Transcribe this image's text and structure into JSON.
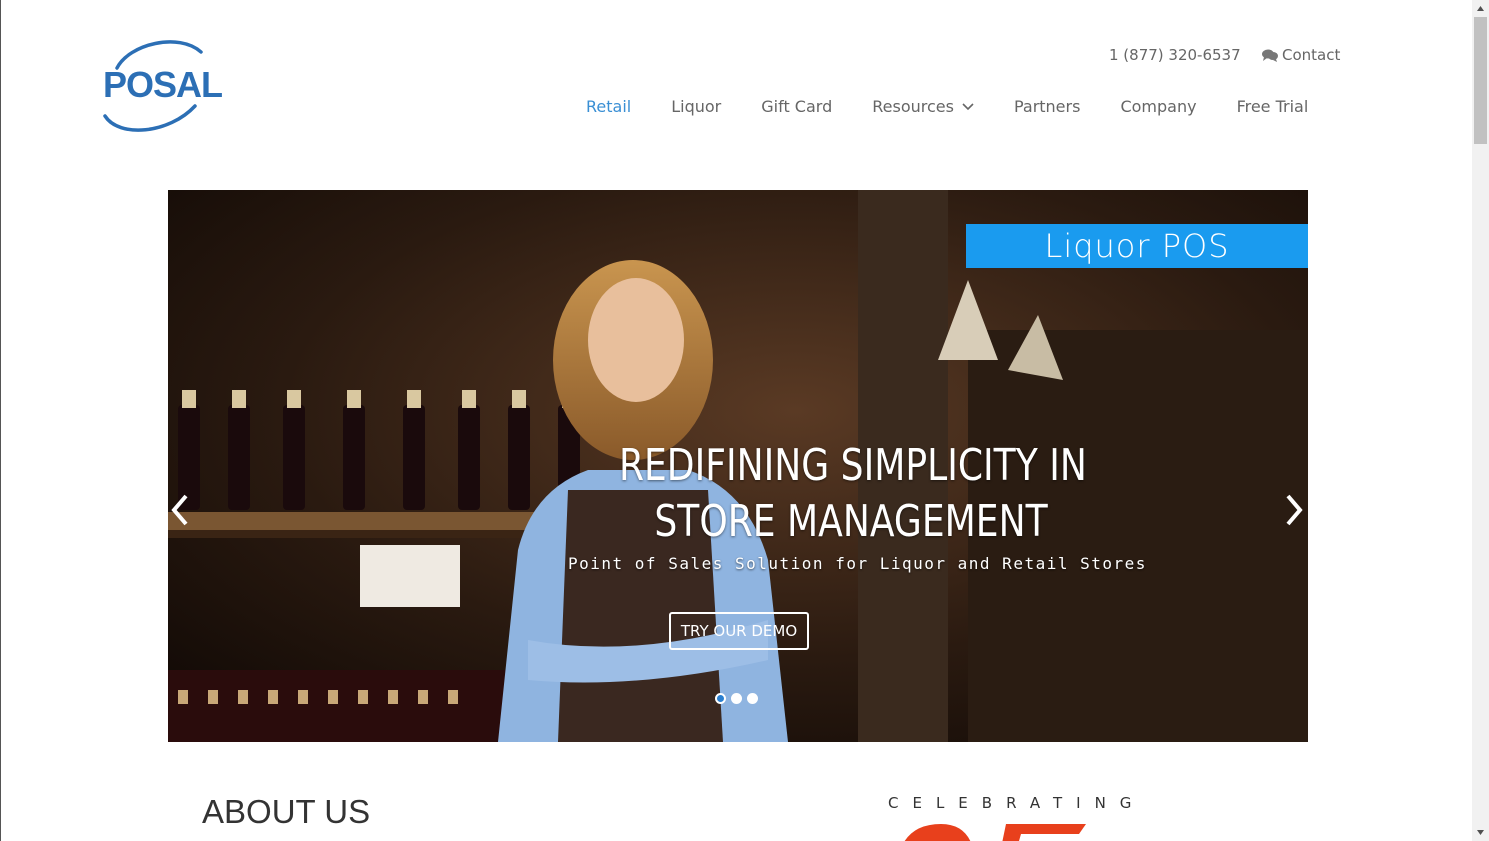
{
  "logo": {
    "text": "POSAL",
    "icon": "posal-swoosh-logo"
  },
  "top_bar": {
    "phone": "1 (877) 320-6537",
    "contact_label": "Contact",
    "contact_icon": "comments-icon"
  },
  "nav": {
    "items": [
      {
        "label": "Retail",
        "active": true
      },
      {
        "label": "Liquor"
      },
      {
        "label": "Gift Card"
      },
      {
        "label": "Resources",
        "dropdown": true
      },
      {
        "label": "Partners"
      },
      {
        "label": "Company"
      },
      {
        "label": "Free Trial"
      }
    ]
  },
  "hero": {
    "badge": "Liquor POS",
    "headline_line1": "REDIFINING SIMPLICITY IN",
    "headline_line2": "STORE MANAGEMENT",
    "subline": "Point of Sales Solution for Liquor and Retail Stores",
    "cta": "TRY OUR DEMO",
    "slide_count": 3,
    "active_slide": 1
  },
  "about": {
    "title": "ABOUT US",
    "celebrating": "CELEBRATING"
  },
  "colors": {
    "brand_blue": "#2c6fb5",
    "nav_active": "#3a8fd4",
    "badge_blue": "#1a9bef",
    "accent_red": "#e8401c",
    "nav_text": "#666666"
  }
}
